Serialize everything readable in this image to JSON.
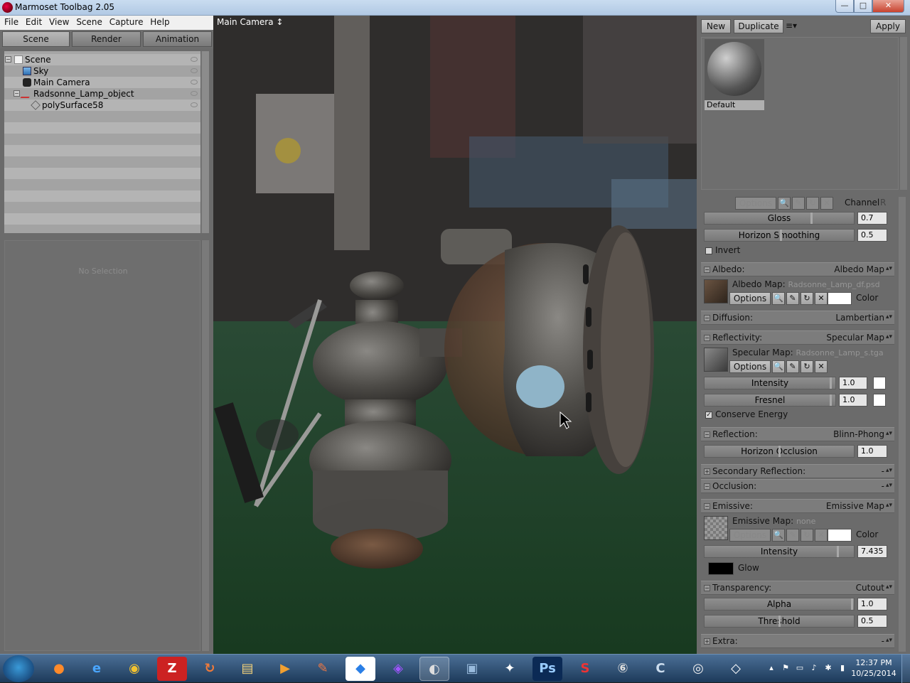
{
  "window": {
    "title": "Marmoset Toolbag 2.05",
    "min_label": "—",
    "max_label": "□",
    "close_label": "✕"
  },
  "menu": [
    "File",
    "Edit",
    "View",
    "Scene",
    "Capture",
    "Help"
  ],
  "left_tabs": [
    "Scene",
    "Render",
    "Animation"
  ],
  "scene_tree": [
    {
      "label": "Scene",
      "icon": "document-icon"
    },
    {
      "label": "Sky",
      "icon": "sky-icon"
    },
    {
      "label": "Main Camera",
      "icon": "camera-icon"
    },
    {
      "label": "Radsonne_Lamp_object",
      "icon": "object-icon"
    },
    {
      "label": "polySurface58",
      "icon": "mesh-icon"
    }
  ],
  "selection": {
    "empty_text": "No Selection"
  },
  "viewport": {
    "camera_label": "Main Camera ↕"
  },
  "material": {
    "buttons": {
      "new": "New",
      "duplicate": "Duplicate",
      "menu": "≡▾",
      "apply": "Apply"
    },
    "selected_name": "Default",
    "top": {
      "options_label": "Options",
      "channel_label": "Channel",
      "channel_value": "R",
      "gloss_label": "Gloss",
      "gloss_value": "0.7",
      "horizon_smoothing_label": "Horizon Smoothing",
      "horizon_smoothing_value": "0.5",
      "invert_label": "Invert"
    },
    "albedo": {
      "section": "Albedo:",
      "mode": "Albedo Map",
      "map_label": "Albedo Map:",
      "file": "Radsonne_Lamp_df.psd",
      "options": "Options",
      "color_label": "Color"
    },
    "diffusion": {
      "section": "Diffusion:",
      "mode": "Lambertian"
    },
    "reflectivity": {
      "section": "Reflectivity:",
      "mode": "Specular Map",
      "map_label": "Specular Map:",
      "file": "Radsonne_Lamp_s.tga",
      "options": "Options",
      "intensity_label": "Intensity",
      "intensity_value": "1.0",
      "fresnel_label": "Fresnel",
      "fresnel_value": "1.0",
      "conserve_label": "Conserve Energy"
    },
    "reflection": {
      "section": "Reflection:",
      "mode": "Blinn-Phong",
      "horizon_occlusion_label": "Horizon Occlusion",
      "horizon_occlusion_value": "1.0"
    },
    "secondary_reflection": {
      "section": "Secondary Reflection:",
      "mode": "-"
    },
    "occlusion": {
      "section": "Occlusion:",
      "mode": "-"
    },
    "emissive": {
      "section": "Emissive:",
      "mode": "Emissive Map",
      "map_label": "Emissive Map:",
      "file": "none",
      "options": "Options",
      "color_label": "Color",
      "intensity_label": "Intensity",
      "intensity_value": "7.435",
      "glow_label": "Glow"
    },
    "transparency": {
      "section": "Transparency:",
      "mode": "Cutout",
      "alpha_label": "Alpha",
      "alpha_value": "1.0",
      "threshold_label": "Threshold",
      "threshold_value": "0.5"
    },
    "extra": {
      "section": "Extra:",
      "mode": "-"
    }
  },
  "icons": {
    "search": "🔍",
    "edit": "✎",
    "reload": "↻",
    "clear": "✕",
    "check": "✓"
  },
  "taskbar": {
    "apps": [
      "Firefox",
      "Internet Explorer",
      "Chrome",
      "FileZilla",
      "Color Tool",
      "File Explorer",
      "Media Player",
      "Paint",
      "Dropbox",
      "Unknown App",
      "Marmoset Toolbag",
      "Terminal",
      "ZBrush",
      "Photoshop",
      "Substance",
      "Photoshop CS",
      "Cinema",
      "Quixel",
      "Marmoset Hub"
    ],
    "time": "12:37 PM",
    "date": "10/25/2014"
  }
}
